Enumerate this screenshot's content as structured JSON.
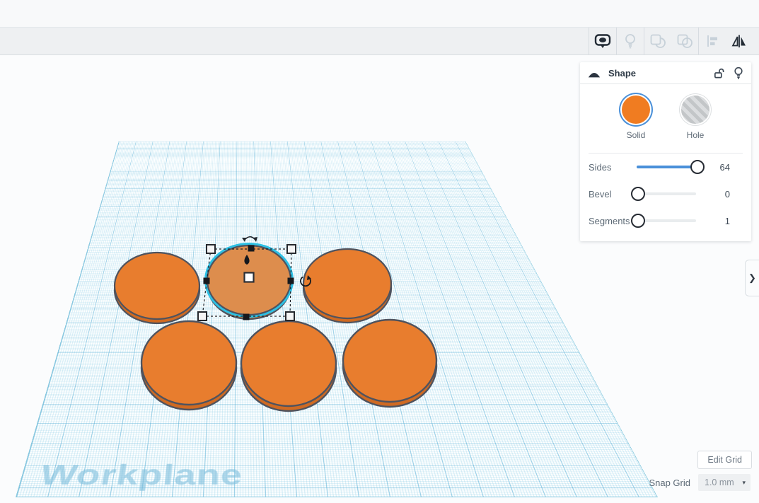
{
  "toolbar": {
    "icons": [
      {
        "name": "notes",
        "state": "active"
      },
      {
        "name": "hide-selected",
        "state": "disabled"
      },
      {
        "name": "group",
        "state": "disabled"
      },
      {
        "name": "ungroup",
        "state": "disabled"
      },
      {
        "name": "align",
        "state": "disabled"
      },
      {
        "name": "flip",
        "state": "active"
      }
    ]
  },
  "shape_panel": {
    "title": "Shape",
    "header_icons": [
      "shape-category",
      "unlock",
      "lightbulb"
    ],
    "material_options": [
      {
        "label": "Solid",
        "selected": true
      },
      {
        "label": "Hole",
        "selected": false
      }
    ],
    "sliders": [
      {
        "label": "Sides",
        "value": "64",
        "fill_pct": 100
      },
      {
        "label": "Bevel",
        "value": "0",
        "fill_pct": 0
      },
      {
        "label": "Segments",
        "value": "1",
        "fill_pct": 0
      }
    ],
    "collapse_glyph": "❯"
  },
  "canvas": {
    "watermark": "Workplane",
    "shapes": {
      "cylinder_count": 6,
      "selected_index": 1
    }
  },
  "grid_controls": {
    "edit_grid_label": "Edit Grid",
    "snap_grid_label": "Snap Grid",
    "snap_grid_value": "1.0 mm",
    "dropdown_caret": "▾"
  },
  "colors": {
    "accent_blue": "#4a90d9",
    "shape_orange": "#e87d2e",
    "shape_orange_selected": "#dd8d4d",
    "selection_cyan": "#2cc0e4",
    "grid_blue": "#7fc4dd"
  }
}
